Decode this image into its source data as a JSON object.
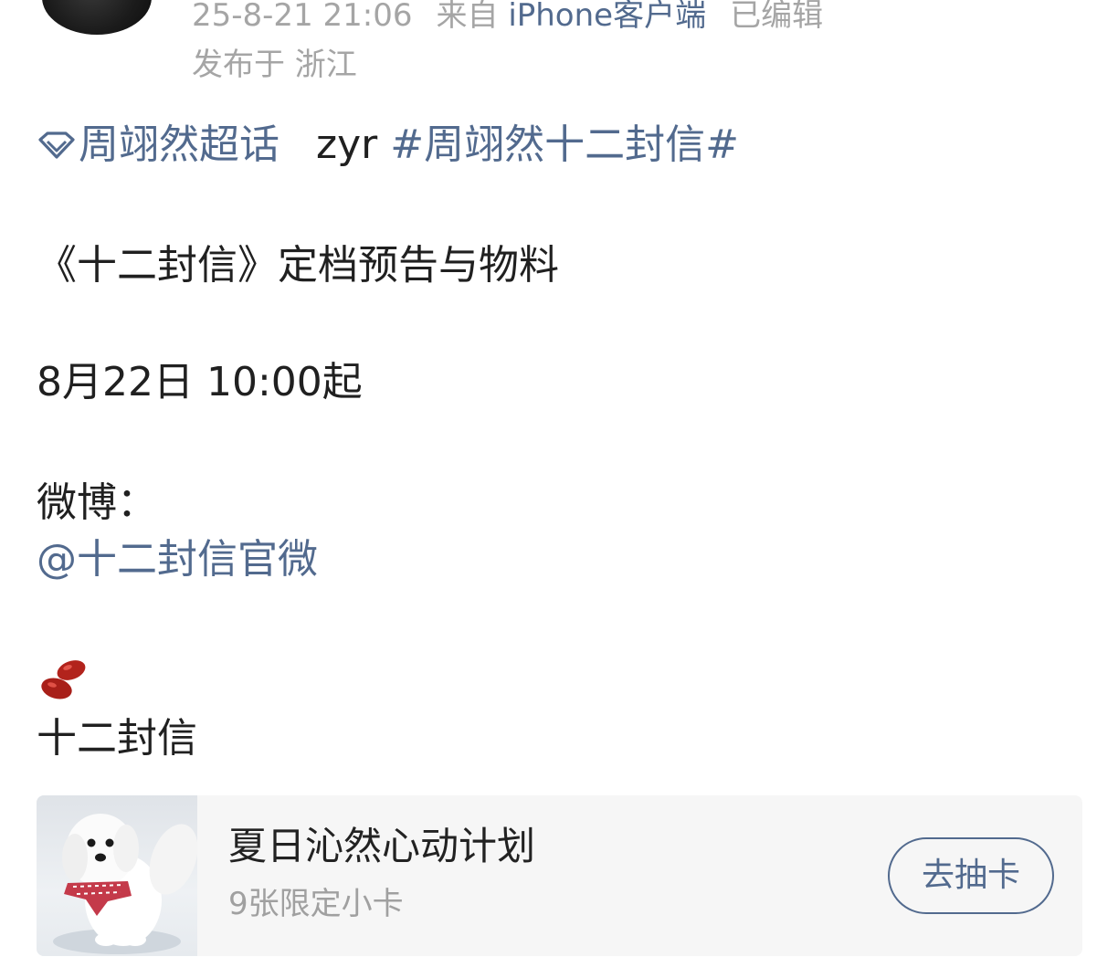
{
  "header": {
    "timestamp": "25-8-21 21:06",
    "source_prefix": "来自",
    "source": "iPhone客户端",
    "edited": "已编辑",
    "location": "发布于 浙江"
  },
  "post": {
    "topic_icon": "diamond-icon",
    "topic": "周翊然超话",
    "author_tag": "zyr",
    "hashtag": "#周翊然十二封信#",
    "line1": "《十二封信》定档预告与物料",
    "line2": "8月22日 10:00起",
    "line3": "微博：",
    "mention": "@十二封信官微",
    "emoji": "red-beans-emoji",
    "line4": "十二封信"
  },
  "card": {
    "title": "夏日沁然心动计划",
    "subtitle": "9张限定小卡",
    "button": "去抽卡"
  },
  "colors": {
    "link": "#526a8e",
    "meta": "#a5a5a5",
    "text": "#202020",
    "card_bg": "#f6f6f6"
  }
}
